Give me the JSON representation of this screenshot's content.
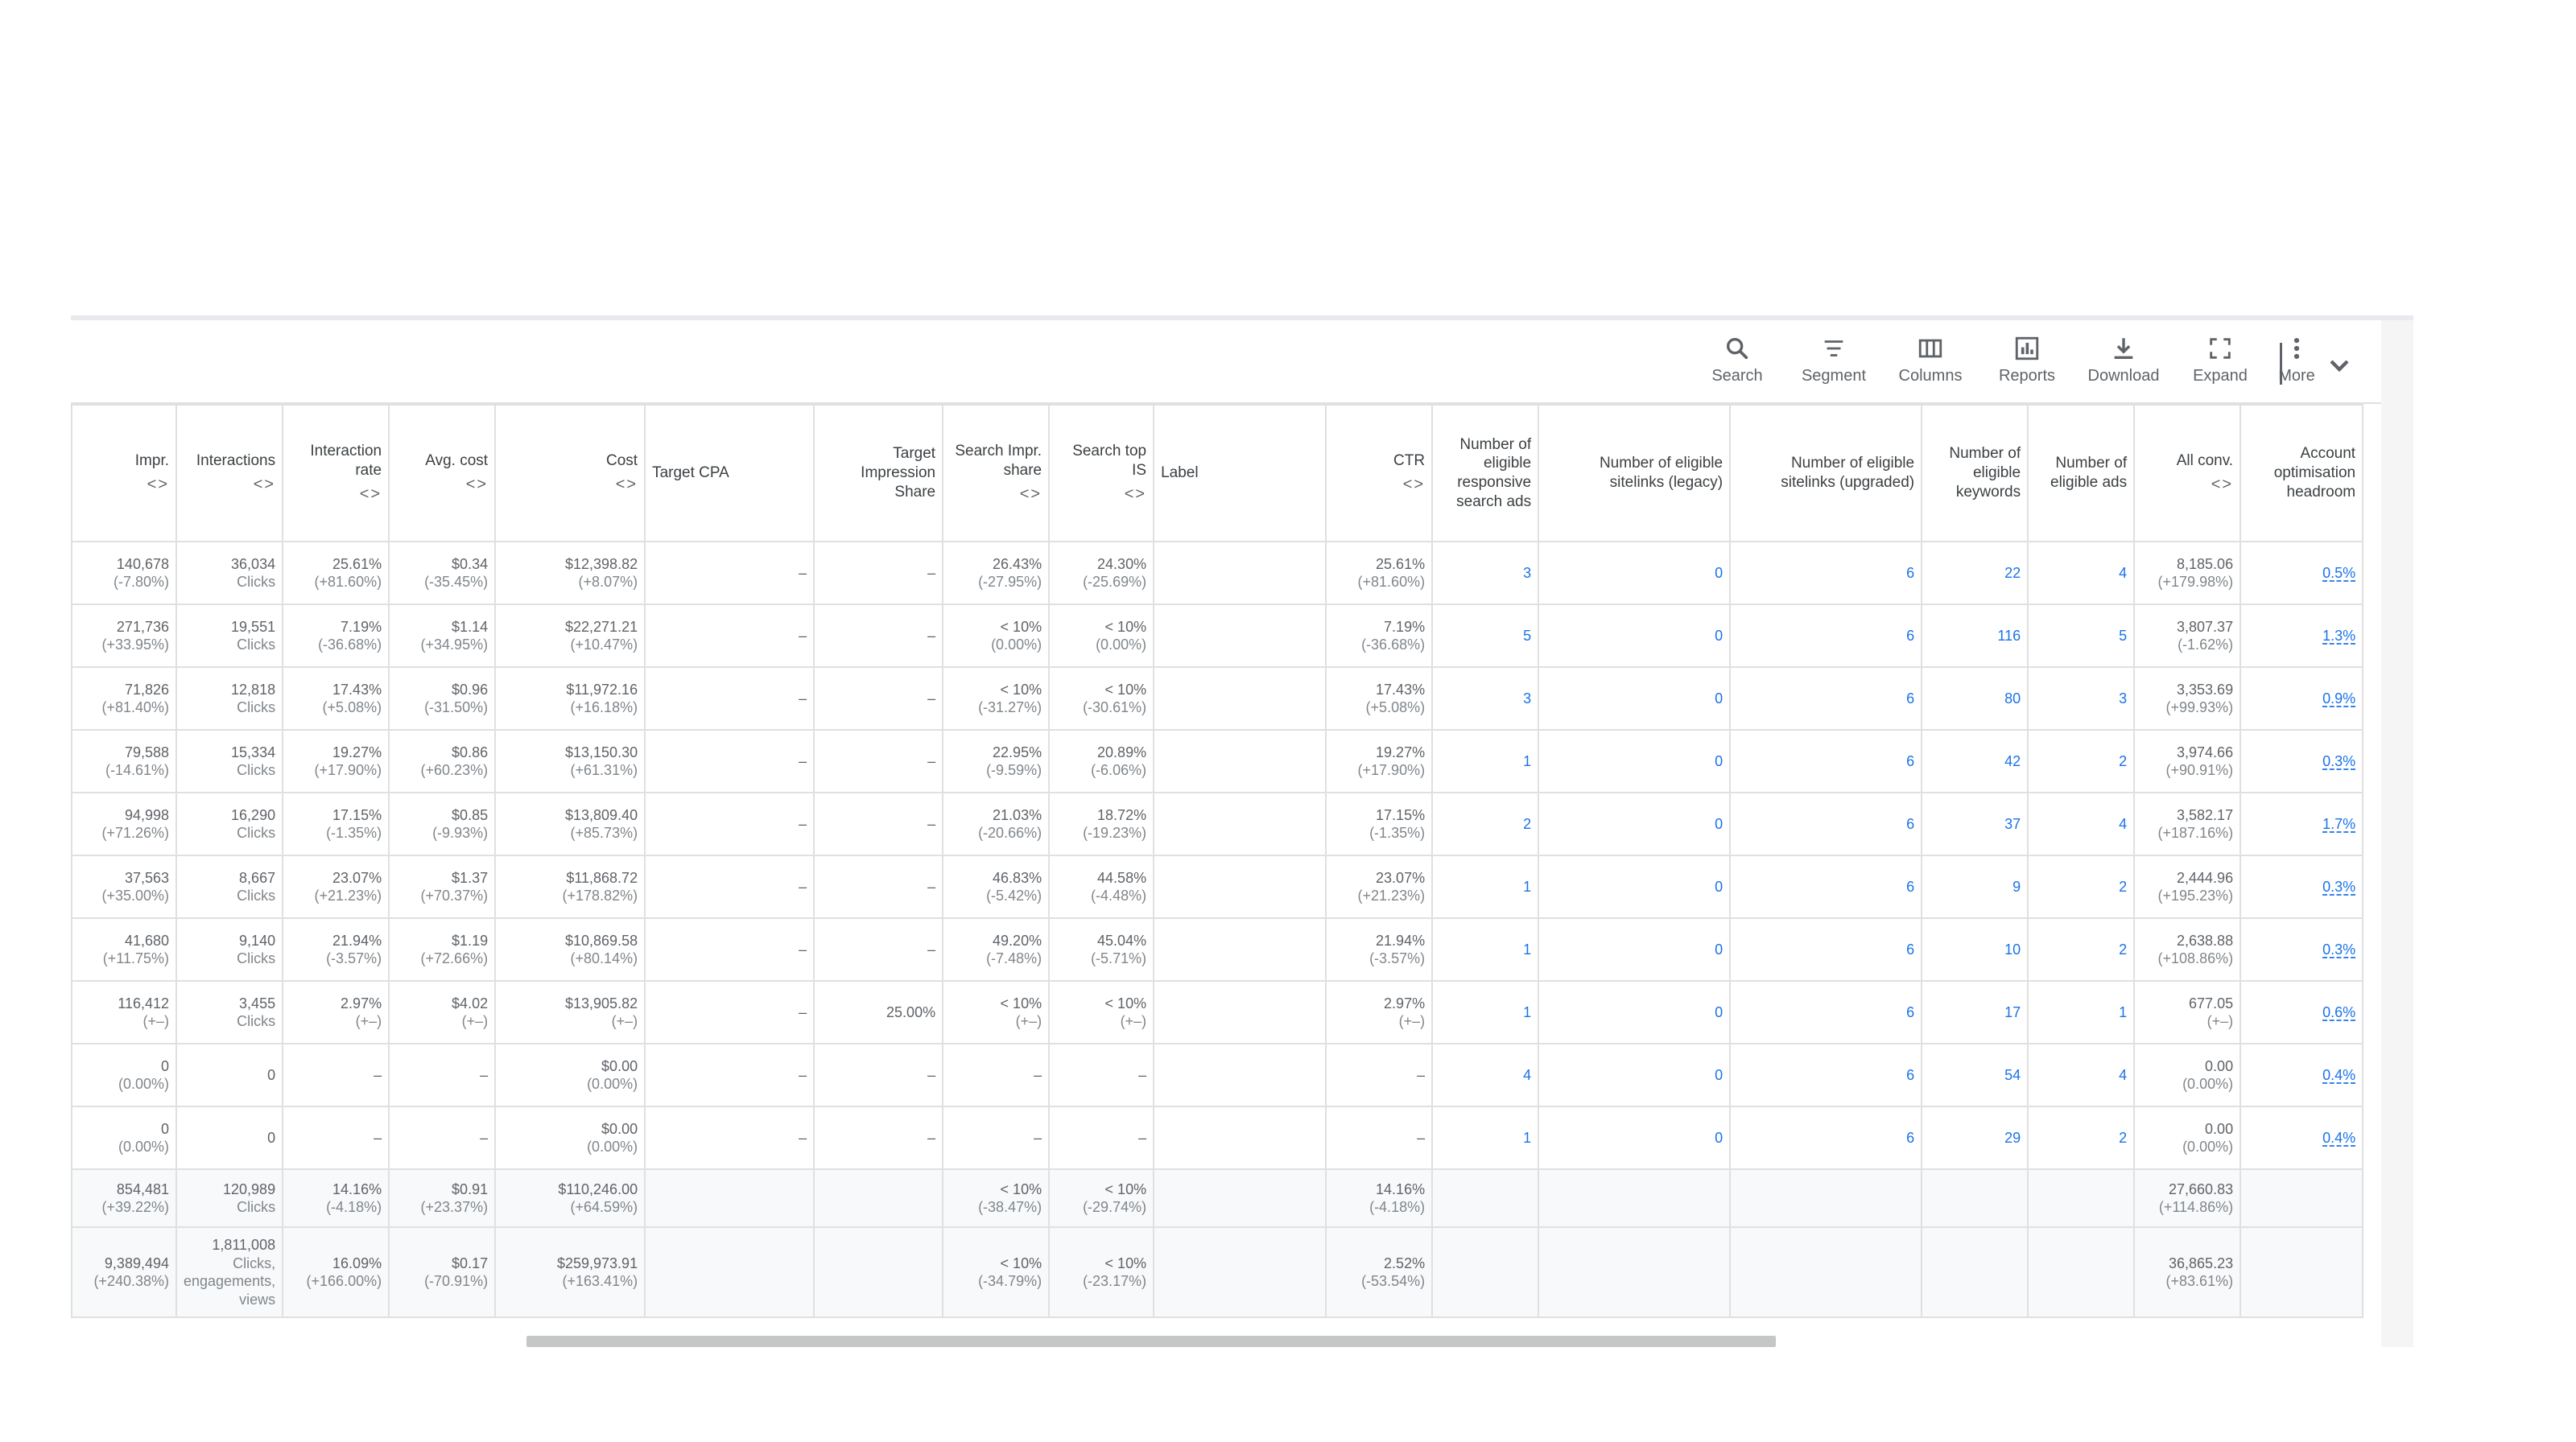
{
  "toolbar": {
    "search": "Search",
    "segment": "Segment",
    "columns": "Columns",
    "reports": "Reports",
    "download": "Download",
    "expand": "Expand",
    "more": "More"
  },
  "headers": {
    "impr": "Impr.",
    "interactions": "Interactions",
    "interaction_rate": "Interaction rate",
    "avg_cost": "Avg. cost",
    "cost": "Cost",
    "target_cpa": "Target CPA",
    "target_is": "Target Impression Share",
    "search_is": "Search Impr. share",
    "search_top_is": "Search top IS",
    "label": "Label",
    "ctr": "CTR",
    "rsa": "Number of eligible responsive search ads",
    "sitelinks_legacy": "Number of eligible sitelinks (legacy)",
    "sitelinks_upgraded": "Number of eligible sitelinks (upgraded)",
    "keywords": "Number of eligible keywords",
    "ads": "Number of eligible ads",
    "all_conv": "All conv.",
    "headroom": "Account optimisation headroom",
    "sort_glyph": "<>"
  },
  "rows": [
    {
      "impr": "140,678",
      "impr_d": "(-7.80%)",
      "inter": "36,034",
      "inter_u": "Clicks",
      "rate": "25.61%",
      "rate_d": "(+81.60%)",
      "avg": "$0.34",
      "avg_d": "(-35.45%)",
      "cost": "$12,398.82",
      "cost_d": "(+8.07%)",
      "tcpa": "–",
      "tis": "–",
      "sis": "26.43%",
      "sis_d": "(-27.95%)",
      "stis": "24.30%",
      "stis_d": "(-25.69%)",
      "ctr": "25.61%",
      "ctr_d": "(+81.60%)",
      "rsa": "3",
      "sll": "0",
      "slu": "6",
      "kw": "22",
      "ads": "4",
      "conv": "8,185.06",
      "conv_d": "(+179.98%)",
      "head": "0.5%"
    },
    {
      "impr": "271,736",
      "impr_d": "(+33.95%)",
      "inter": "19,551",
      "inter_u": "Clicks",
      "rate": "7.19%",
      "rate_d": "(-36.68%)",
      "avg": "$1.14",
      "avg_d": "(+34.95%)",
      "cost": "$22,271.21",
      "cost_d": "(+10.47%)",
      "tcpa": "–",
      "tis": "–",
      "sis": "< 10%",
      "sis_d": "(0.00%)",
      "stis": "< 10%",
      "stis_d": "(0.00%)",
      "ctr": "7.19%",
      "ctr_d": "(-36.68%)",
      "rsa": "5",
      "sll": "0",
      "slu": "6",
      "kw": "116",
      "ads": "5",
      "conv": "3,807.37",
      "conv_d": "(-1.62%)",
      "head": "1.3%"
    },
    {
      "impr": "71,826",
      "impr_d": "(+81.40%)",
      "inter": "12,818",
      "inter_u": "Clicks",
      "rate": "17.43%",
      "rate_d": "(+5.08%)",
      "avg": "$0.96",
      "avg_d": "(-31.50%)",
      "cost": "$11,972.16",
      "cost_d": "(+16.18%)",
      "tcpa": "–",
      "tis": "–",
      "sis": "< 10%",
      "sis_d": "(-31.27%)",
      "stis": "< 10%",
      "stis_d": "(-30.61%)",
      "ctr": "17.43%",
      "ctr_d": "(+5.08%)",
      "rsa": "3",
      "sll": "0",
      "slu": "6",
      "kw": "80",
      "ads": "3",
      "conv": "3,353.69",
      "conv_d": "(+99.93%)",
      "head": "0.9%"
    },
    {
      "impr": "79,588",
      "impr_d": "(-14.61%)",
      "inter": "15,334",
      "inter_u": "Clicks",
      "rate": "19.27%",
      "rate_d": "(+17.90%)",
      "avg": "$0.86",
      "avg_d": "(+60.23%)",
      "cost": "$13,150.30",
      "cost_d": "(+61.31%)",
      "tcpa": "–",
      "tis": "–",
      "sis": "22.95%",
      "sis_d": "(-9.59%)",
      "stis": "20.89%",
      "stis_d": "(-6.06%)",
      "ctr": "19.27%",
      "ctr_d": "(+17.90%)",
      "rsa": "1",
      "sll": "0",
      "slu": "6",
      "kw": "42",
      "ads": "2",
      "conv": "3,974.66",
      "conv_d": "(+90.91%)",
      "head": "0.3%"
    },
    {
      "impr": "94,998",
      "impr_d": "(+71.26%)",
      "inter": "16,290",
      "inter_u": "Clicks",
      "rate": "17.15%",
      "rate_d": "(-1.35%)",
      "avg": "$0.85",
      "avg_d": "(-9.93%)",
      "cost": "$13,809.40",
      "cost_d": "(+85.73%)",
      "tcpa": "–",
      "tis": "–",
      "sis": "21.03%",
      "sis_d": "(-20.66%)",
      "stis": "18.72%",
      "stis_d": "(-19.23%)",
      "ctr": "17.15%",
      "ctr_d": "(-1.35%)",
      "rsa": "2",
      "sll": "0",
      "slu": "6",
      "kw": "37",
      "ads": "4",
      "conv": "3,582.17",
      "conv_d": "(+187.16%)",
      "head": "1.7%"
    },
    {
      "impr": "37,563",
      "impr_d": "(+35.00%)",
      "inter": "8,667",
      "inter_u": "Clicks",
      "rate": "23.07%",
      "rate_d": "(+21.23%)",
      "avg": "$1.37",
      "avg_d": "(+70.37%)",
      "cost": "$11,868.72",
      "cost_d": "(+178.82%)",
      "tcpa": "–",
      "tis": "–",
      "sis": "46.83%",
      "sis_d": "(-5.42%)",
      "stis": "44.58%",
      "stis_d": "(-4.48%)",
      "ctr": "23.07%",
      "ctr_d": "(+21.23%)",
      "rsa": "1",
      "sll": "0",
      "slu": "6",
      "kw": "9",
      "ads": "2",
      "conv": "2,444.96",
      "conv_d": "(+195.23%)",
      "head": "0.3%"
    },
    {
      "impr": "41,680",
      "impr_d": "(+11.75%)",
      "inter": "9,140",
      "inter_u": "Clicks",
      "rate": "21.94%",
      "rate_d": "(-3.57%)",
      "avg": "$1.19",
      "avg_d": "(+72.66%)",
      "cost": "$10,869.58",
      "cost_d": "(+80.14%)",
      "tcpa": "–",
      "tis": "–",
      "sis": "49.20%",
      "sis_d": "(-7.48%)",
      "stis": "45.04%",
      "stis_d": "(-5.71%)",
      "ctr": "21.94%",
      "ctr_d": "(-3.57%)",
      "rsa": "1",
      "sll": "0",
      "slu": "6",
      "kw": "10",
      "ads": "2",
      "conv": "2,638.88",
      "conv_d": "(+108.86%)",
      "head": "0.3%"
    },
    {
      "impr": "116,412",
      "impr_d": "(+–)",
      "inter": "3,455",
      "inter_u": "Clicks",
      "rate": "2.97%",
      "rate_d": "(+–)",
      "avg": "$4.02",
      "avg_d": "(+–)",
      "cost": "$13,905.82",
      "cost_d": "(+–)",
      "tcpa": "–",
      "tis": "25.00%",
      "sis": "< 10%",
      "sis_d": "(+–)",
      "stis": "< 10%",
      "stis_d": "(+–)",
      "ctr": "2.97%",
      "ctr_d": "(+–)",
      "rsa": "1",
      "sll": "0",
      "slu": "6",
      "kw": "17",
      "ads": "1",
      "conv": "677.05",
      "conv_d": "(+–)",
      "head": "0.6%"
    },
    {
      "impr": "0",
      "impr_d": "(0.00%)",
      "inter": "0",
      "inter_u": "",
      "rate": "–",
      "rate_d": "",
      "avg": "–",
      "avg_d": "",
      "cost": "$0.00",
      "cost_d": "(0.00%)",
      "tcpa": "–",
      "tis": "–",
      "sis": "–",
      "sis_d": "",
      "stis": "–",
      "stis_d": "",
      "ctr": "–",
      "ctr_d": "",
      "rsa": "4",
      "sll": "0",
      "slu": "6",
      "kw": "54",
      "ads": "4",
      "conv": "0.00",
      "conv_d": "(0.00%)",
      "head": "0.4%"
    },
    {
      "impr": "0",
      "impr_d": "(0.00%)",
      "inter": "0",
      "inter_u": "",
      "rate": "–",
      "rate_d": "",
      "avg": "–",
      "avg_d": "",
      "cost": "$0.00",
      "cost_d": "(0.00%)",
      "tcpa": "–",
      "tis": "–",
      "sis": "–",
      "sis_d": "",
      "stis": "–",
      "stis_d": "",
      "ctr": "–",
      "ctr_d": "",
      "rsa": "1",
      "sll": "0",
      "slu": "6",
      "kw": "29",
      "ads": "2",
      "conv": "0.00",
      "conv_d": "(0.00%)",
      "head": "0.4%"
    }
  ],
  "total1": {
    "impr": "854,481",
    "impr_d": "(+39.22%)",
    "inter": "120,989",
    "inter_u": "Clicks",
    "rate": "14.16%",
    "rate_d": "(-4.18%)",
    "avg": "$0.91",
    "avg_d": "(+23.37%)",
    "cost": "$110,246.00",
    "cost_d": "(+64.59%)",
    "sis": "< 10%",
    "sis_d": "(-38.47%)",
    "stis": "< 10%",
    "stis_d": "(-29.74%)",
    "ctr": "14.16%",
    "ctr_d": "(-4.18%)",
    "conv": "27,660.83",
    "conv_d": "(+114.86%)"
  },
  "total2": {
    "impr": "9,389,494",
    "impr_d": "(+240.38%)",
    "inter": "1,811,008",
    "inter_u1": "Clicks,",
    "inter_u2": "engagements,",
    "inter_u3": "views",
    "rate": "16.09%",
    "rate_d": "(+166.00%)",
    "avg": "$0.17",
    "avg_d": "(-70.91%)",
    "cost": "$259,973.91",
    "cost_d": "(+163.41%)",
    "sis": "< 10%",
    "sis_d": "(-34.79%)",
    "stis": "< 10%",
    "stis_d": "(-23.17%)",
    "ctr": "2.52%",
    "ctr_d": "(-53.54%)",
    "conv": "36,865.23",
    "conv_d": "(+83.61%)"
  }
}
